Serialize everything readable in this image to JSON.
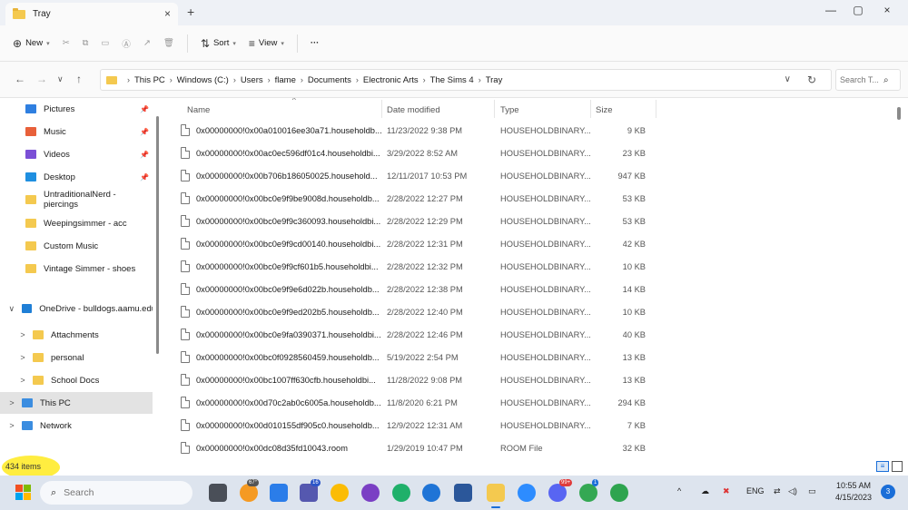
{
  "window": {
    "tab_title": "Tray",
    "tab_close": "×",
    "new_tab": "+",
    "minimize": "—",
    "maximize": "▢",
    "close": "×"
  },
  "toolbar": {
    "new_label": "New",
    "sort_label": "Sort",
    "view_label": "View",
    "more": "···"
  },
  "address": {
    "crumbs": [
      "This PC",
      "Windows (C:)",
      "Users",
      "flame",
      "Documents",
      "Electronic Arts",
      "The Sims 4",
      "Tray"
    ],
    "search_placeholder": "Search T..."
  },
  "sidebar": {
    "quick_access": [
      {
        "label": "Pictures",
        "icon": "pictures-icon",
        "color": "#2f7fe0",
        "pinned": true
      },
      {
        "label": "Music",
        "icon": "music-icon",
        "color": "#e8603a",
        "pinned": true
      },
      {
        "label": "Videos",
        "icon": "videos-icon",
        "color": "#7b4fd6",
        "pinned": true
      },
      {
        "label": "Desktop",
        "icon": "desktop-icon",
        "color": "#1f8fe0",
        "pinned": true
      },
      {
        "label": "UntraditionalNerd - piercings",
        "icon": "folder-icon",
        "color": "#f4c94f",
        "pinned": false
      },
      {
        "label": "Weepingsimmer - acc",
        "icon": "folder-icon",
        "color": "#f4c94f",
        "pinned": false
      },
      {
        "label": "Custom Music",
        "icon": "folder-icon",
        "color": "#f4c94f",
        "pinned": false
      },
      {
        "label": "Vintage Simmer - shoes",
        "icon": "folder-icon",
        "color": "#f4c94f",
        "pinned": false
      }
    ],
    "tree": [
      {
        "label": "OneDrive - bulldogs.aamu.edu",
        "icon": "onedrive-icon",
        "color": "#1f7fd6",
        "expander": "∨",
        "indent": 6
      },
      {
        "label": "Attachments",
        "icon": "folder-icon",
        "color": "#f4c94f",
        "expander": ">",
        "indent": 18
      },
      {
        "label": "personal",
        "icon": "folder-icon",
        "color": "#f4c94f",
        "expander": ">",
        "indent": 18
      },
      {
        "label": "School Docs",
        "icon": "folder-icon",
        "color": "#f4c94f",
        "expander": ">",
        "indent": 18
      },
      {
        "label": "This PC",
        "icon": "this-pc-icon",
        "color": "#3b8de0",
        "expander": ">",
        "indent": 6,
        "selected": true
      },
      {
        "label": "Network",
        "icon": "network-icon",
        "color": "#3b8de0",
        "expander": ">",
        "indent": 6
      }
    ]
  },
  "columns": {
    "name": "Name",
    "date": "Date modified",
    "type": "Type",
    "size": "Size"
  },
  "files": [
    {
      "name": "0x00000000!0x00a010016ee30a71.householdb...",
      "date": "11/23/2022 9:38 PM",
      "type": "HOUSEHOLDBINARY...",
      "size": "9 KB"
    },
    {
      "name": "0x00000000!0x00ac0ec596df01c4.householdbi...",
      "date": "3/29/2022 8:52 AM",
      "type": "HOUSEHOLDBINARY...",
      "size": "23 KB"
    },
    {
      "name": "0x00000000!0x00b706b186050025.household...",
      "date": "12/11/2017 10:53 PM",
      "type": "HOUSEHOLDBINARY...",
      "size": "947 KB"
    },
    {
      "name": "0x00000000!0x00bc0e9f9be9008d.householdb...",
      "date": "2/28/2022 12:27 PM",
      "type": "HOUSEHOLDBINARY...",
      "size": "53 KB"
    },
    {
      "name": "0x00000000!0x00bc0e9f9c360093.householdbi...",
      "date": "2/28/2022 12:29 PM",
      "type": "HOUSEHOLDBINARY...",
      "size": "53 KB"
    },
    {
      "name": "0x00000000!0x00bc0e9f9cd00140.householdbi...",
      "date": "2/28/2022 12:31 PM",
      "type": "HOUSEHOLDBINARY...",
      "size": "42 KB"
    },
    {
      "name": "0x00000000!0x00bc0e9f9cf601b5.householdbi...",
      "date": "2/28/2022 12:32 PM",
      "type": "HOUSEHOLDBINARY...",
      "size": "10 KB"
    },
    {
      "name": "0x00000000!0x00bc0e9f9e6d022b.householdb...",
      "date": "2/28/2022 12:38 PM",
      "type": "HOUSEHOLDBINARY...",
      "size": "14 KB"
    },
    {
      "name": "0x00000000!0x00bc0e9f9ed202b5.householdb...",
      "date": "2/28/2022 12:40 PM",
      "type": "HOUSEHOLDBINARY...",
      "size": "10 KB"
    },
    {
      "name": "0x00000000!0x00bc0e9fa0390371.householdbi...",
      "date": "2/28/2022 12:46 PM",
      "type": "HOUSEHOLDBINARY...",
      "size": "40 KB"
    },
    {
      "name": "0x00000000!0x00bc0f0928560459.householdb...",
      "date": "5/19/2022 2:54 PM",
      "type": "HOUSEHOLDBINARY...",
      "size": "13 KB"
    },
    {
      "name": "0x00000000!0x00bc1007ff630cfb.householdbi...",
      "date": "11/28/2022 9:08 PM",
      "type": "HOUSEHOLDBINARY...",
      "size": "13 KB"
    },
    {
      "name": "0x00000000!0x00d70c2ab0c6005a.householdb...",
      "date": "11/8/2020 6:21 PM",
      "type": "HOUSEHOLDBINARY...",
      "size": "294 KB"
    },
    {
      "name": "0x00000000!0x00d010155df905c0.householdb...",
      "date": "12/9/2022 12:31 AM",
      "type": "HOUSEHOLDBINARY...",
      "size": "7 KB"
    },
    {
      "name": "0x00000000!0x00dc08d35fd10043.room",
      "date": "1/29/2019 10:47 PM",
      "type": "ROOM File",
      "size": "32 KB"
    }
  ],
  "status": {
    "items_count": "434 items"
  },
  "taskbar": {
    "search_placeholder": "Search",
    "weather_badge": "67°",
    "teams_badge": "16",
    "discord_badge": "99+",
    "chrome_badge": "1",
    "lang": "ENG",
    "time": "10:55 AM",
    "date": "4/15/2023",
    "notification_count": "3"
  }
}
